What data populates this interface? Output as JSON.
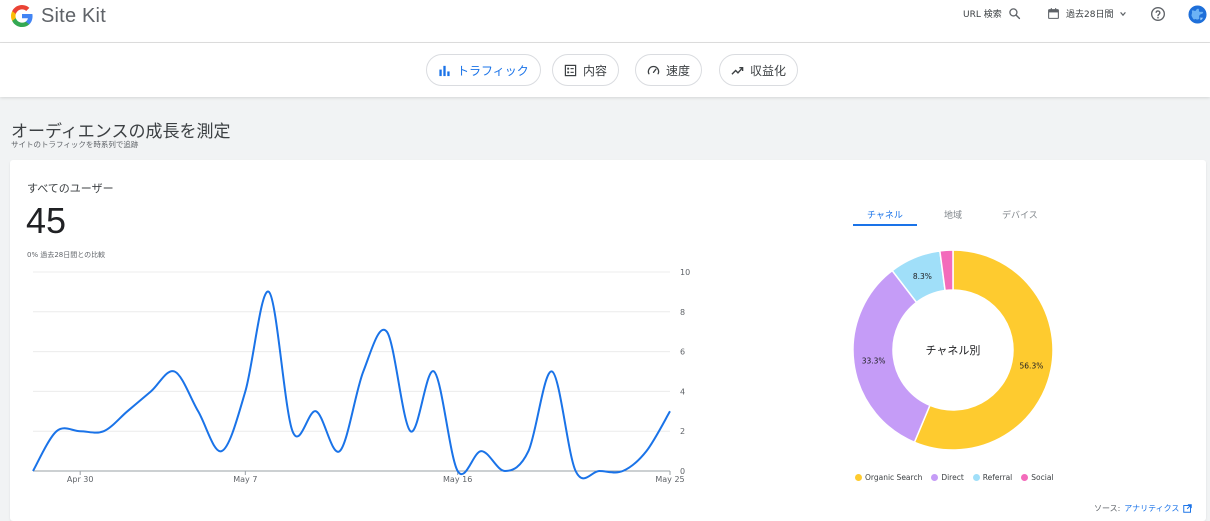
{
  "header": {
    "app_name": "Site Kit",
    "url_search_label": "URL 検索",
    "date_range_label": "過去28日間"
  },
  "nav": {
    "tabs": [
      {
        "label": "トラフィック",
        "active": true
      },
      {
        "label": "内容",
        "active": false
      },
      {
        "label": "速度",
        "active": false
      },
      {
        "label": "収益化",
        "active": false
      }
    ]
  },
  "section": {
    "title": "オーディエンスの成長を測定",
    "subtitle": "サイトのトラフィックを時系列で追跡"
  },
  "metric": {
    "label": "すべてのユーザー",
    "value": "45",
    "comparison": "0% 過去28日間との比較"
  },
  "breakdown_tabs": [
    "チャネル",
    "地域",
    "デバイス"
  ],
  "source": {
    "prefix": "ソース:",
    "link_text": "アナリティクス"
  },
  "chart_data": [
    {
      "type": "line",
      "x_tick_labels": [
        "Apr 30",
        "May 7",
        "May 16",
        "May 25"
      ],
      "x": [
        "Apr 28",
        "Apr 29",
        "Apr 30",
        "May 1",
        "May 2",
        "May 3",
        "May 4",
        "May 5",
        "May 6",
        "May 7",
        "May 8",
        "May 9",
        "May 10",
        "May 11",
        "May 12",
        "May 13",
        "May 14",
        "May 15",
        "May 16",
        "May 17",
        "May 18",
        "May 19",
        "May 20",
        "May 21",
        "May 22",
        "May 23",
        "May 24",
        "May 25"
      ],
      "series": [
        {
          "values": [
            0,
            2,
            2,
            2,
            3,
            4,
            5,
            3,
            1,
            4,
            9,
            2,
            3,
            1,
            5,
            7,
            2,
            5,
            0,
            1,
            0,
            1,
            5,
            0,
            0,
            0,
            1,
            3
          ],
          "color": "#1a73e8"
        }
      ],
      "ylim": [
        0,
        10
      ],
      "y_ticks": [
        0,
        2,
        4,
        6,
        8,
        10
      ],
      "grid": true
    },
    {
      "type": "pie",
      "donut": true,
      "center_label": "チャネル別",
      "slices": [
        {
          "label": "Organic Search",
          "value": 56.3,
          "color": "#fecb2f"
        },
        {
          "label": "Direct",
          "value": 33.3,
          "color": "#c59cf7"
        },
        {
          "label": "Referral",
          "value": 8.3,
          "color": "#a0dff9"
        },
        {
          "label": "Social",
          "value": 2.1,
          "color": "#f36bbb"
        }
      ],
      "legend_position": "bottom"
    }
  ]
}
